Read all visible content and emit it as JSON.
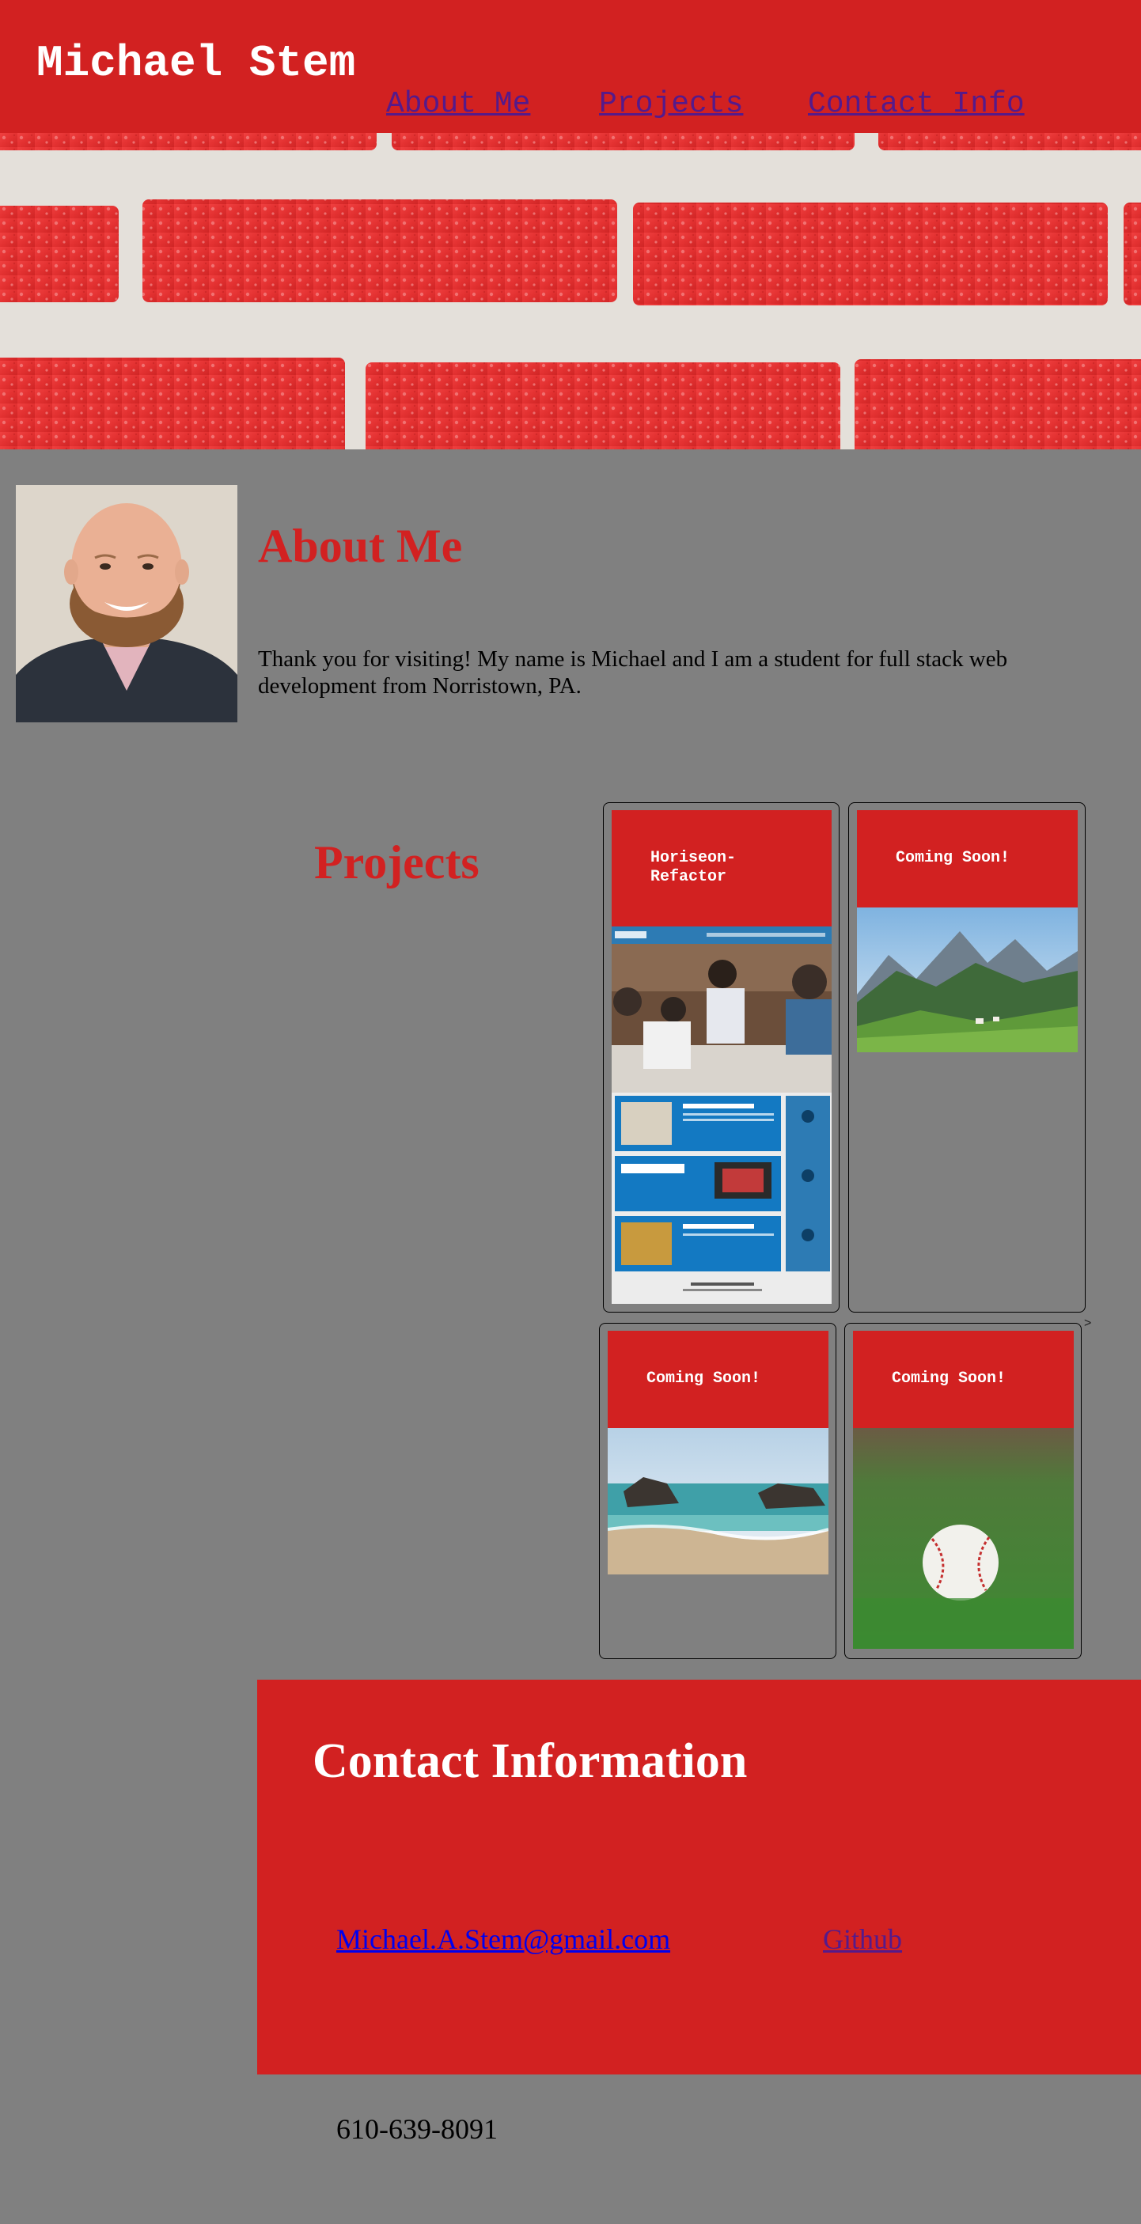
{
  "header": {
    "site_name": "Michael Stem",
    "nav": [
      {
        "label": "About Me"
      },
      {
        "label": "Projects"
      },
      {
        "label": "Contact Info"
      }
    ]
  },
  "about": {
    "title": "About Me",
    "text": "Thank you for visiting! My name is Michael and I am a student for full stack web development from Norristown, PA."
  },
  "projects": {
    "title": "Projects",
    "cards": [
      {
        "title": "Horiseon-Refactor",
        "image": "horiseon-site-screenshot"
      },
      {
        "title": "Coming Soon!",
        "image": "mountain-valley-photo"
      },
      {
        "title": "Coming Soon!",
        "image": "beach-rocks-photo"
      },
      {
        "title": "Coming Soon!",
        "image": "baseball-on-grass-photo"
      }
    ],
    "stray_text": ">"
  },
  "contact": {
    "title": "Contact Information",
    "email": "Michael.A.Stem@gmail.com",
    "github": "Github",
    "phone": "610-639-8091"
  },
  "colors": {
    "brand_red": "#d22121",
    "page_gray": "#808080",
    "link_unvisited": "#0000ee",
    "link_visited": "#551a8b"
  }
}
